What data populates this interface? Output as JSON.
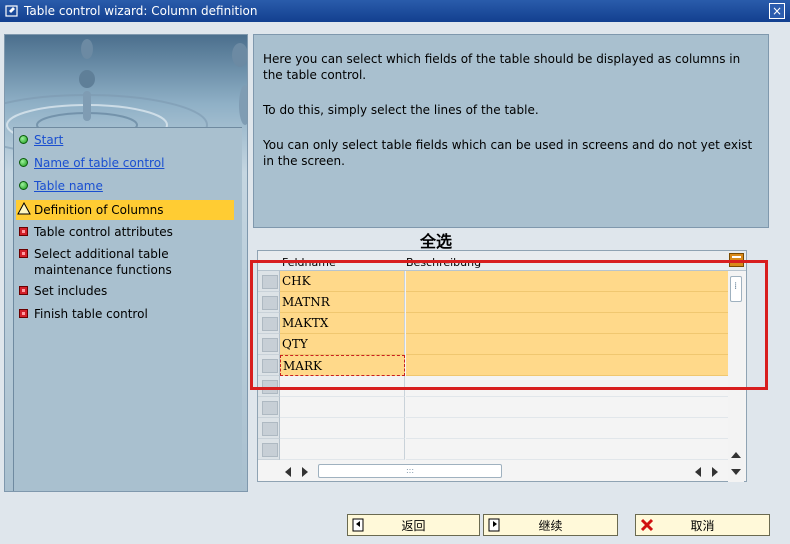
{
  "window": {
    "title": "Table control wizard: Column definition",
    "close_glyph": "×"
  },
  "steps": [
    {
      "label": "Start",
      "status": "done",
      "link": true
    },
    {
      "label": "Name of table control",
      "status": "done",
      "link": true
    },
    {
      "label": "Table name",
      "status": "done",
      "link": true
    },
    {
      "label": "Definition of Columns",
      "status": "current",
      "link": false
    },
    {
      "label": "Table control attributes",
      "status": "pending",
      "link": false
    },
    {
      "label": "Select additional table maintenance functions",
      "status": "pending",
      "link": false
    },
    {
      "label": "Set includes",
      "status": "pending",
      "link": false
    },
    {
      "label": "Finish table control",
      "status": "pending",
      "link": false
    }
  ],
  "info": {
    "line1": "Here you can select which fields of the table should be displayed as columns in the table control.",
    "line2": "To do this, simply select the lines of the table.",
    "line3": "You can only select table fields which can be used in screens and do not yet exist in the screen."
  },
  "select_all_label": "全选",
  "table": {
    "columns": [
      "Feldname",
      "Beschreibung"
    ],
    "rows": [
      {
        "field": "CHK",
        "desc": ""
      },
      {
        "field": "MATNR",
        "desc": ""
      },
      {
        "field": "MAKTX",
        "desc": ""
      },
      {
        "field": "QTY",
        "desc": ""
      },
      {
        "field": "MARK",
        "desc": ""
      }
    ],
    "empty_rows": 4
  },
  "buttons": {
    "back": "返回",
    "next": "继续",
    "cancel": "取消"
  },
  "colors": {
    "title_bar": "#1f4f9f",
    "panel": "#a9c0cf",
    "active_step": "#ffcc33",
    "selected_row": "#ffd98a",
    "highlight_frame": "#d81e1e"
  }
}
